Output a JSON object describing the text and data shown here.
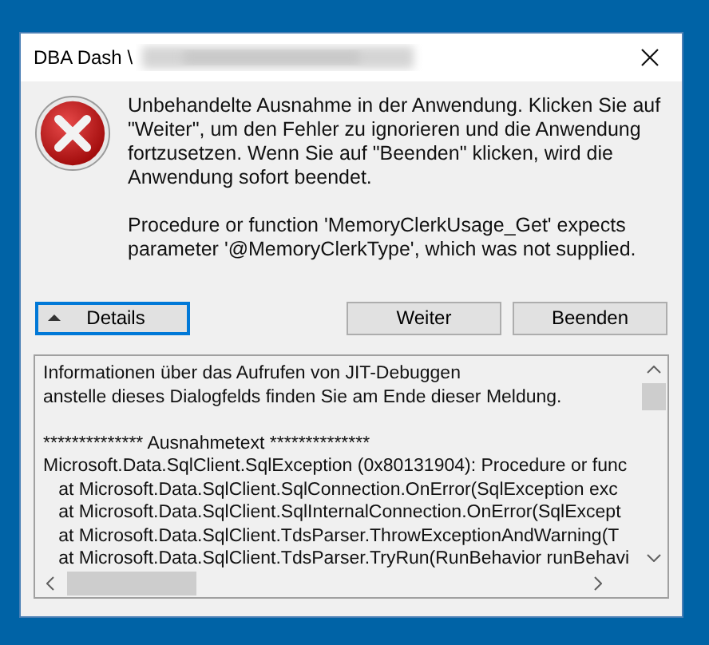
{
  "window": {
    "title": "DBA Dash \\"
  },
  "message": {
    "paragraphs": [
      "Unbehandelte Ausnahme in der Anwendung. Klicken Sie auf \"Weiter\", um den Fehler zu ignorieren und die Anwendung fortzusetzen. Wenn Sie auf \"Beenden\" klicken, wird die Anwendung sofort beendet.",
      "Procedure or function 'MemoryClerkUsage_Get' expects parameter '@MemoryClerkType', which was not supplied."
    ]
  },
  "buttons": [
    {
      "label": "Details",
      "kind": "toggle",
      "expanded": true,
      "focused": true
    },
    {
      "label": "Weiter",
      "kind": "push",
      "focused": false
    },
    {
      "label": "Beenden",
      "kind": "push",
      "focused": false
    }
  ],
  "details": {
    "blocks": [
      [
        "Informationen über das Aufrufen von JIT-Debuggen",
        "anstelle dieses Dialogfelds finden Sie am Ende dieser Meldung."
      ],
      [
        "************** Ausnahmetext **************",
        "Microsoft.Data.SqlClient.SqlException (0x80131904): Procedure or func",
        "   at Microsoft.Data.SqlClient.SqlConnection.OnError(SqlException exc",
        "   at Microsoft.Data.SqlClient.SqlInternalConnection.OnError(SqlExcept",
        "   at Microsoft.Data.SqlClient.TdsParser.ThrowExceptionAndWarning(T",
        "   at Microsoft.Data.SqlClient.TdsParser.TryRun(RunBehavior runBehavi"
      ]
    ]
  }
}
